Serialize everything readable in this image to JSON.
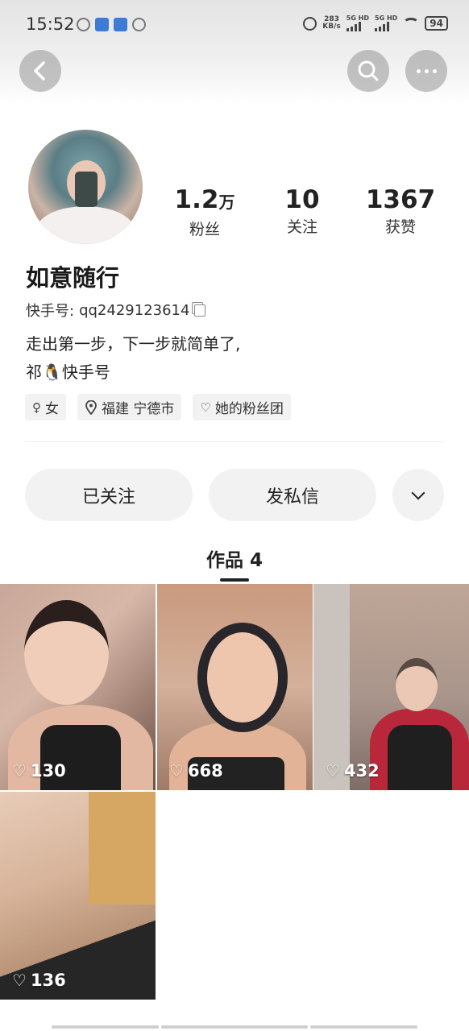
{
  "status_bar": {
    "time": "15:52",
    "net_speed": "283",
    "net_unit": "KB/s",
    "sim1": "5G HD",
    "sim2": "5G HD",
    "battery": "94"
  },
  "icons": {
    "back": "back-arrow-icon",
    "search": "search-icon",
    "more": "more-dots-icon",
    "copy": "copy-icon",
    "gender": "female-icon",
    "location": "location-pin-icon",
    "fan_group": "heart-outline-icon",
    "chevron": "chevron-down-icon",
    "like": "heart-icon"
  },
  "profile": {
    "nickname": "如意随行",
    "kwai_id_label": "快手号:",
    "kwai_id": "qq2429123614",
    "bio_line1": "走出第一步，下一步就简单了,",
    "bio_line2": "祁🐧快手号"
  },
  "stats": {
    "fans_value": "1.2",
    "fans_unit": "万",
    "fans_label": "粉丝",
    "following_value": "10",
    "following_label": "关注",
    "likes_value": "1367",
    "likes_label": "获赞"
  },
  "tags": {
    "gender": "女",
    "location": "福建 宁德市",
    "fan_group": "她的粉丝团"
  },
  "actions": {
    "followed": "已关注",
    "message": "发私信"
  },
  "works": {
    "tab_label": "作品 4",
    "items": [
      {
        "likes": "130"
      },
      {
        "likes": "668"
      },
      {
        "likes": "432"
      },
      {
        "likes": "136"
      }
    ]
  }
}
